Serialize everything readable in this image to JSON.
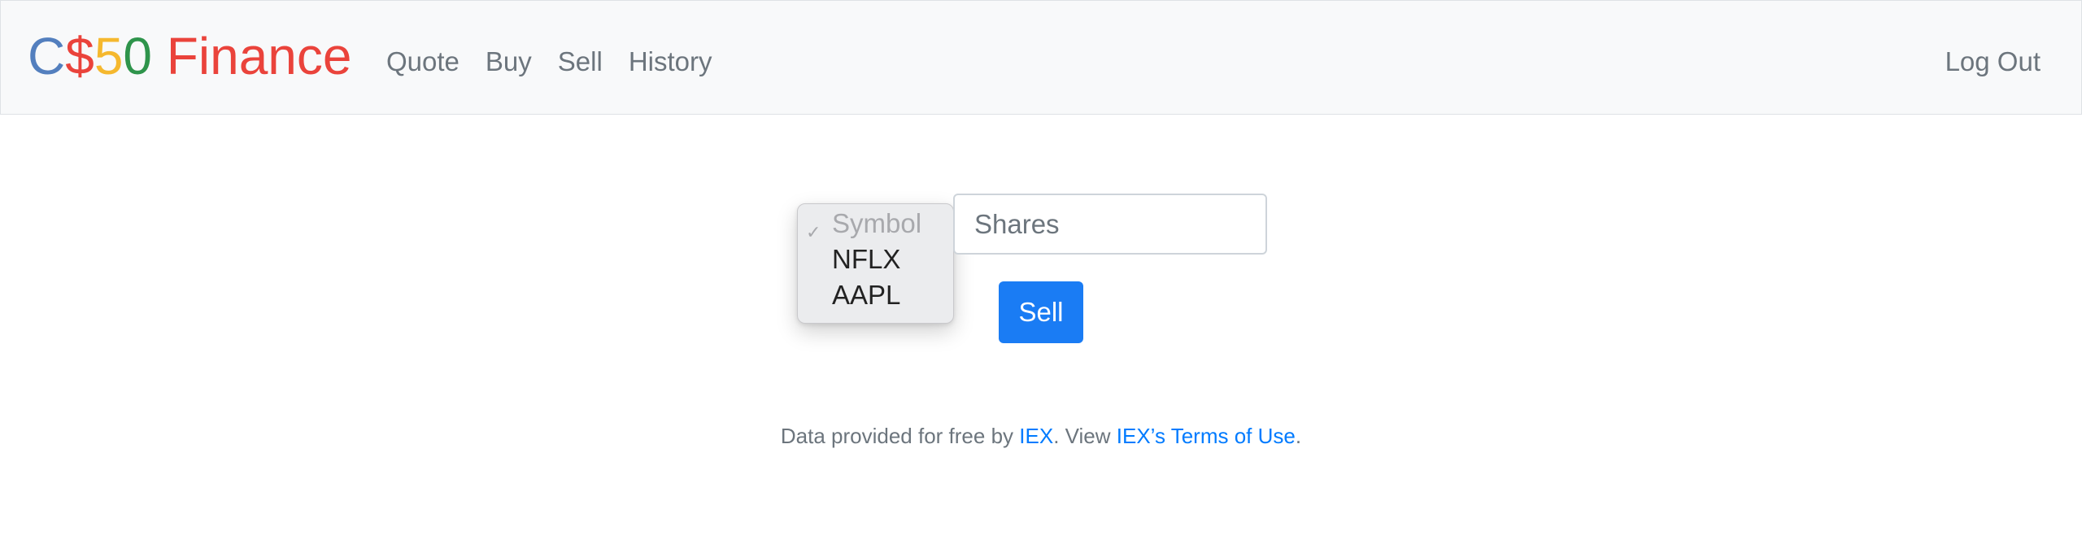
{
  "brand": {
    "parts": [
      {
        "text": "C",
        "color": "#537fbe"
      },
      {
        "text": "$",
        "color": "#ea433b"
      },
      {
        "text": "5",
        "color": "#f5b82e"
      },
      {
        "text": "0",
        "color": "#2e944b"
      },
      {
        "text": " Finance",
        "color": "#ea433b"
      }
    ]
  },
  "nav": {
    "links": [
      "Quote",
      "Buy",
      "Sell",
      "History"
    ],
    "logout": "Log Out"
  },
  "form": {
    "symbol_select": {
      "options": [
        "Symbol",
        "NFLX",
        "AAPL"
      ],
      "selected": "Symbol",
      "check_glyph": "✓"
    },
    "shares_placeholder": "Shares",
    "submit_label": "Sell"
  },
  "footer": {
    "prefix": "Data provided for free by ",
    "iex_link": "IEX",
    "middle": ". View ",
    "terms_link": "IEX’s Terms of Use",
    "suffix": "."
  },
  "colors": {
    "primary": "#1a7cf4",
    "link": "#007bff",
    "navbar_bg": "#f8f9fa"
  }
}
